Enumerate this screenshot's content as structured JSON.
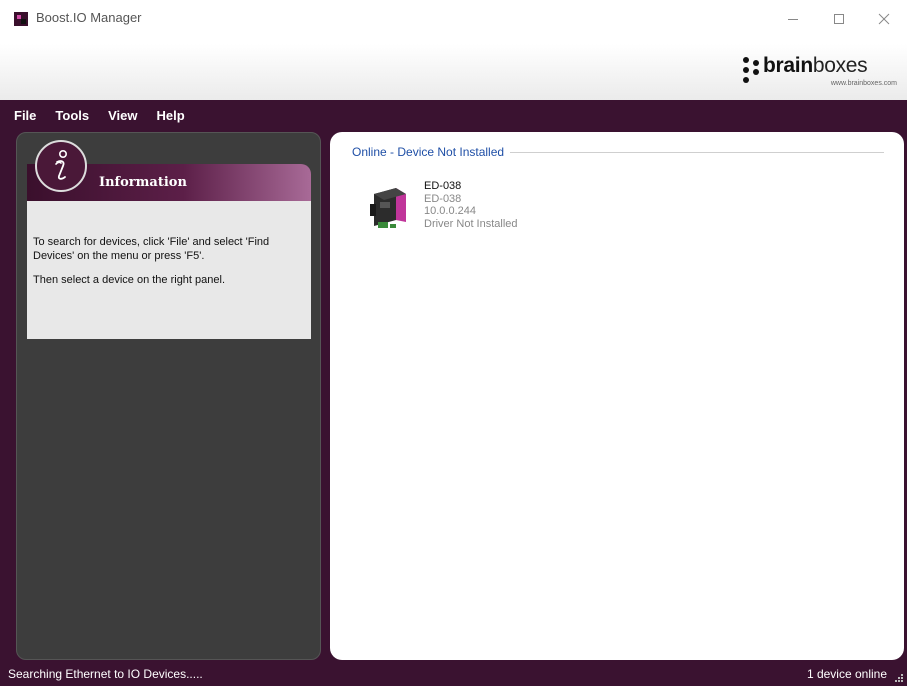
{
  "window": {
    "title": "Boost.IO Manager",
    "controls": [
      "minimize",
      "maximize",
      "close"
    ]
  },
  "brand": {
    "name_bold": "brain",
    "name_light": "boxes",
    "url": "www.brainboxes.com"
  },
  "menu": {
    "items": [
      "File",
      "Tools",
      "View",
      "Help"
    ]
  },
  "info_panel": {
    "title": "Information",
    "paragraph1": "To search for devices, click 'File' and select 'Find Devices' on the menu or press 'F5'.",
    "paragraph2": "Then select a device on the right panel."
  },
  "devices_panel": {
    "group_title": "Online - Device Not Installed",
    "devices": [
      {
        "name": "ED-038",
        "model": "ED-038",
        "ip": "10.0.0.244",
        "status": "Driver Not Installed"
      }
    ]
  },
  "statusbar": {
    "left": "Searching Ethernet to IO Devices.....",
    "right": "1 device online"
  },
  "colors": {
    "accent": "#3a1230",
    "panel_dark": "#3d3d3d",
    "group_title": "#1f4fa6",
    "device_pink": "#c0359a"
  }
}
